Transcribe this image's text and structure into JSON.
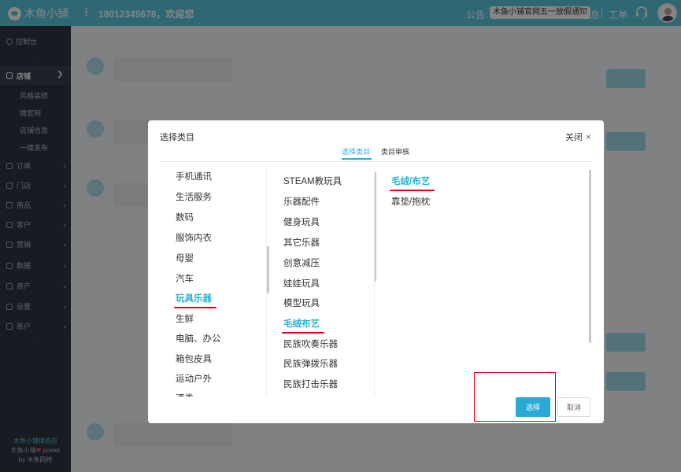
{
  "topbar": {
    "logo_text": "木鱼小铺",
    "more_icon": "⋮",
    "account_text": "18012345678，欢迎您",
    "notice_label": "公告:",
    "notice_text": "木鱼小铺官网五一放假通知",
    "messages_label": "消息",
    "separator": "|",
    "worklist_label": "工单"
  },
  "sidebar": {
    "dashboard_label": "控制台",
    "dots": "···",
    "shop_label": "店铺",
    "shop_subitems": [
      "风格装修",
      "微官网",
      "店铺信息",
      "一键发布"
    ],
    "menu_items": [
      "订单",
      "门店",
      "商品",
      "客户",
      "营销",
      "数据",
      "资产",
      "设置",
      "账户"
    ],
    "footer_store": "木鱼小铺体验店",
    "footer_power_prefix": "木鱼小铺",
    "footer_power_suffix": "power",
    "footer_by": "by 木鱼网络"
  },
  "modal": {
    "title": "选择类目",
    "close_label": "关闭",
    "close_icon": "×",
    "tabs": [
      "选择类目",
      "类目审核"
    ],
    "column1": [
      "手机通讯",
      "生活服务",
      "数码",
      "服饰内衣",
      "母婴",
      "汽车",
      "玩具乐器",
      "生鲜",
      "电脑、办公",
      "箱包皮具",
      "运动户外",
      "酒类"
    ],
    "column1_selected": "玩具乐器",
    "column2": [
      "STEAM教玩具",
      "乐器配件",
      "健身玩具",
      "其它乐器",
      "创意减压",
      "娃娃玩具",
      "模型玩具",
      "毛绒布艺",
      "民族吹奏乐器",
      "民族弹拨乐器",
      "民族打击乐器"
    ],
    "column2_selected": "毛绒布艺",
    "column3": [
      "毛绒/布艺",
      "靠垫/抱枕"
    ],
    "column3_selected": "毛绒/布艺",
    "select_button": "选择",
    "cancel_button": "取消"
  },
  "colors": {
    "topbar": "#5bc6dc",
    "sidebar": "#2f3440",
    "accent": "#2db0d3",
    "annotation_red": "#e3001b",
    "primary_button": "#2aa9d6"
  }
}
